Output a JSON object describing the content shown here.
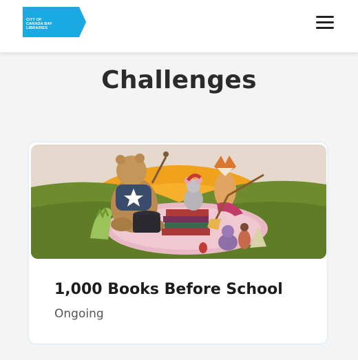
{
  "header": {
    "logo_lines": [
      "CITY OF",
      "CANADA BAY",
      "LIBRARIES"
    ],
    "logo_color": "#1aa9e1",
    "menu_icon": "hamburger-menu-icon"
  },
  "page": {
    "title": "Challenges"
  },
  "challenges": [
    {
      "title": "1,000 Books Before School",
      "status": "Ongoing",
      "image": "illustration of a bear, fox, mouse and dinosaur reading books on a rug"
    }
  ]
}
